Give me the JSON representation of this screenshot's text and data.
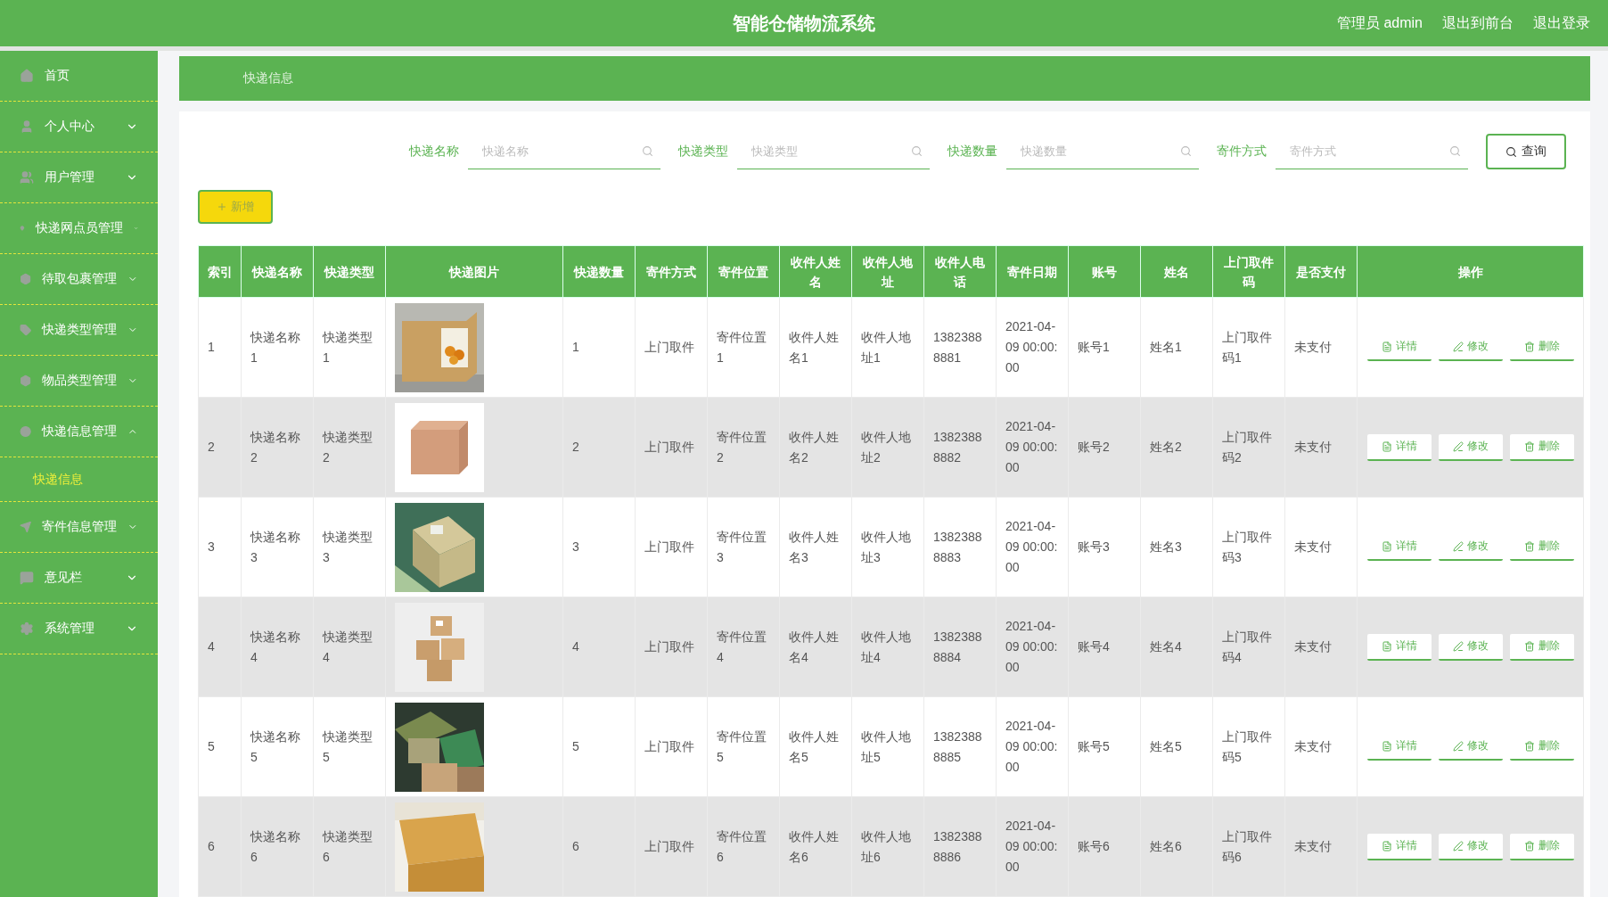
{
  "header": {
    "title": "智能仓储物流系统",
    "links": [
      "管理员 admin",
      "退出到前台",
      "退出登录"
    ]
  },
  "sidebar": {
    "items": [
      {
        "label": "首页"
      },
      {
        "label": "个人中心",
        "expanded": false
      },
      {
        "label": "用户管理",
        "expanded": false
      },
      {
        "label": "快递网点员管理",
        "expanded": false
      },
      {
        "label": "待取包裹管理",
        "expanded": false
      },
      {
        "label": "快递类型管理",
        "expanded": false
      },
      {
        "label": "物品类型管理",
        "expanded": false
      },
      {
        "label": "快递信息管理",
        "expanded": true,
        "children": [
          {
            "label": "快递信息",
            "selected": true
          }
        ]
      },
      {
        "label": "寄件信息管理",
        "expanded": false
      },
      {
        "label": "意见栏",
        "expanded": false
      },
      {
        "label": "系统管理",
        "expanded": false
      }
    ]
  },
  "breadcrumb": "快递信息",
  "search": {
    "fields": [
      {
        "label": "快递名称",
        "placeholder": "快递名称"
      },
      {
        "label": "快递类型",
        "placeholder": "快递类型"
      },
      {
        "label": "快递数量",
        "placeholder": "快递数量"
      },
      {
        "label": "寄件方式",
        "placeholder": "寄件方式"
      }
    ],
    "button": "查询"
  },
  "add_button": "新增",
  "table": {
    "columns": [
      {
        "label": "索引",
        "kind": "text"
      },
      {
        "label": "快递名称",
        "kind": "text"
      },
      {
        "label": "快递类型",
        "kind": "text"
      },
      {
        "label": "快递图片"
      },
      {
        "label": "快递数量",
        "kind": "text"
      },
      {
        "label": "寄件方式",
        "kind": "text"
      },
      {
        "label": "寄件位置",
        "kind": "text"
      },
      {
        "label": "收件人姓名",
        "kind": "text"
      },
      {
        "label": "收件人地址",
        "kind": "text"
      },
      {
        "label": "收件人电话",
        "kind": "text"
      },
      {
        "label": "寄件日期",
        "kind": "text"
      },
      {
        "label": "账号",
        "kind": "text"
      },
      {
        "label": "姓名",
        "kind": "text"
      },
      {
        "label": "上门取件码",
        "kind": "text"
      },
      {
        "label": "是否支付",
        "kind": "text"
      },
      {
        "label": "操作",
        "kind": "actions"
      }
    ],
    "rows": [
      {
        "cells": [
          "1",
          "快递名称1",
          "快递类型1",
          {
            "kind": "picture"
          },
          "1",
          "上门取件",
          "寄件位置1",
          "收件人姓名1",
          "收件人地址1",
          "13823888881",
          "2021-04-09 00:00:00",
          "账号1",
          "姓名1",
          "上门取件码1",
          "未支付"
        ],
        "actions": [
          {
            "kind": "detail",
            "label": "详情"
          },
          {
            "kind": "edit",
            "label": "修改"
          },
          {
            "kind": "delete",
            "label": "删除"
          }
        ]
      },
      {
        "cells": [
          "2",
          "快递名称2",
          "快递类型2",
          {
            "kind": "picture"
          },
          "2",
          "上门取件",
          "寄件位置2",
          "收件人姓名2",
          "收件人地址2",
          "13823888882",
          "2021-04-09 00:00:00",
          "账号2",
          "姓名2",
          "上门取件码2",
          "未支付"
        ],
        "actions": [
          {
            "kind": "detail",
            "label": "详情"
          },
          {
            "kind": "edit",
            "label": "修改"
          },
          {
            "kind": "delete",
            "label": "删除"
          }
        ]
      },
      {
        "cells": [
          "3",
          "快递名称3",
          "快递类型3",
          {
            "kind": "picture"
          },
          "3",
          "上门取件",
          "寄件位置3",
          "收件人姓名3",
          "收件人地址3",
          "13823888883",
          "2021-04-09 00:00:00",
          "账号3",
          "姓名3",
          "上门取件码3",
          "未支付"
        ],
        "actions": [
          {
            "kind": "detail",
            "label": "详情"
          },
          {
            "kind": "edit",
            "label": "修改"
          },
          {
            "kind": "delete",
            "label": "删除"
          }
        ]
      },
      {
        "cells": [
          "4",
          "快递名称4",
          "快递类型4",
          {
            "kind": "picture"
          },
          "4",
          "上门取件",
          "寄件位置4",
          "收件人姓名4",
          "收件人地址4",
          "13823888884",
          "2021-04-09 00:00:00",
          "账号4",
          "姓名4",
          "上门取件码4",
          "未支付"
        ],
        "actions": [
          {
            "kind": "detail",
            "label": "详情"
          },
          {
            "kind": "edit",
            "label": "修改"
          },
          {
            "kind": "delete",
            "label": "删除"
          }
        ]
      },
      {
        "cells": [
          "5",
          "快递名称5",
          "快递类型5",
          {
            "kind": "picture"
          },
          "5",
          "上门取件",
          "寄件位置5",
          "收件人姓名5",
          "收件人地址5",
          "13823888885",
          "2021-04-09 00:00:00",
          "账号5",
          "姓名5",
          "上门取件码5",
          "未支付"
        ],
        "actions": [
          {
            "kind": "detail",
            "label": "详情"
          },
          {
            "kind": "edit",
            "label": "修改"
          },
          {
            "kind": "delete",
            "label": "删除"
          }
        ]
      },
      {
        "cells": [
          "6",
          "快递名称6",
          "快递类型6",
          {
            "kind": "picture"
          },
          "6",
          "上门取件",
          "寄件位置6",
          "收件人姓名6",
          "收件人地址6",
          "13823888886",
          "2021-04-09 00:00:00",
          "账号6",
          "姓名6",
          "上门取件码6",
          "未支付"
        ],
        "actions": [
          {
            "kind": "detail",
            "label": "详情"
          },
          {
            "kind": "edit",
            "label": "修改"
          },
          {
            "kind": "delete",
            "label": "删除"
          }
        ]
      }
    ]
  }
}
